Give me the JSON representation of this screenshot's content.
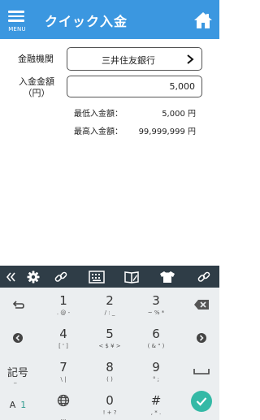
{
  "header": {
    "menu_label": "MENU",
    "title": "クイック入金",
    "background": "#3b97e0",
    "home_icon": "home-icon"
  },
  "form": {
    "bank_label": "金融機関",
    "bank_value": "三井住友銀行",
    "amount_label_line1": "入金金額",
    "amount_label_line2": "（円）",
    "amount_value": "5,000",
    "min_label": "最低入金額：",
    "min_value": "5,000 円",
    "max_label": "最高入金額：",
    "max_value": "99,999,999 円"
  },
  "keyboard": {
    "toolbar_icons": [
      "collapse-icon",
      "gear-icon",
      "link-icon",
      "keyboard-icon",
      "dictionary-icon",
      "shirt-icon",
      "link-icon"
    ],
    "keys": [
      {
        "main": "1",
        "sub": ". @ -"
      },
      {
        "main": "2",
        "sub": "/ : _"
      },
      {
        "main": "3",
        "sub": "~ % *"
      },
      {
        "main": "4",
        "sub": "[ ' ]"
      },
      {
        "main": "5",
        "sub": "< $ ¥ >"
      },
      {
        "main": "6",
        "sub": "( & \" )"
      },
      {
        "main": "7",
        "sub": "\\ |"
      },
      {
        "main": "8",
        "sub": "(     )"
      },
      {
        "main": "9",
        "sub": "°    ;"
      },
      {
        "main": "0",
        "sub": "! + ?"
      },
      {
        "main": "#",
        "sub": ", * ."
      }
    ],
    "kigou_label": "記号",
    "kigou_sub": "_",
    "kana_a": "A",
    "kana_1": "1",
    "space_sub": "...",
    "accent_color": "#34b9a6"
  }
}
